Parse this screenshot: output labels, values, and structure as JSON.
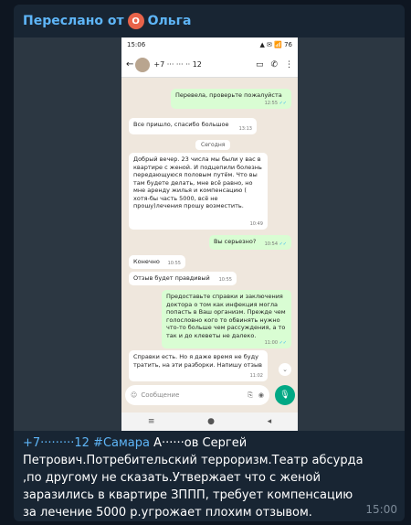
{
  "forward": {
    "prefix": "Переслано от",
    "avatar_letter": "О",
    "sender": "Ольга"
  },
  "screenshot": {
    "status_time": "15:06",
    "status_right": "▲ ✉ 📶 76",
    "contact": "+7 ··· ··· ·· 12",
    "messages": [
      {
        "dir": "out",
        "text": "Перевела, проверьте пожалуйста",
        "time": "12:55"
      },
      {
        "dir": "in",
        "text": "Все пришло, спасибо большое",
        "time": "13:13"
      },
      {
        "dir": "in",
        "text": "Добрый вечер. 23 числа мы были у вас в квартире с женой. И подцепили болезнь передающуюся половым путём. Что вы там будете делать, мне всё равно, но мне аренду жилья и компенсацию ( хотя-бы часть 5000, всё не прошу)лечения прошу возместить.",
        "time": "10:49"
      },
      {
        "dir": "out",
        "text": "Вы серьезно?",
        "time": "10:54"
      },
      {
        "dir": "in",
        "text": "Конечно",
        "time": "10:55"
      },
      {
        "dir": "in",
        "text": "Отзыв будет правдивый",
        "time": "10:55"
      },
      {
        "dir": "out",
        "text": "Предоставьте справки и заключения доктора о том как инфекция могла попасть в Ваш организм. Прежде чем голословно кого то обвинять нужно что-то больше чем рассуждения, а то так и до клеветы не далеко.",
        "time": "11:00"
      },
      {
        "dir": "in",
        "text": "Справки есть. Но я даже время не буду тратить, на эти разборки. Напишу отзыв",
        "time": "11:02"
      }
    ],
    "date_pill": "Сегодня",
    "input_placeholder": "Сообщение"
  },
  "caption": {
    "phone_link": "+7·········12",
    "hashtag": "#Самара",
    "text": " А······ов Сергей Петрович.Потребительский терроризм.Театр абсурда ,по другому не сказать.Утвержает что с женой заразились в квартире ЗППП, требует компенсацию за лечение 5000 р.угрожает плохим отзывом.",
    "time": "15:00"
  },
  "colors": {
    "accent": "#5eb5f7",
    "bubble_out": "#d9fdd3",
    "mic": "#00a884"
  }
}
